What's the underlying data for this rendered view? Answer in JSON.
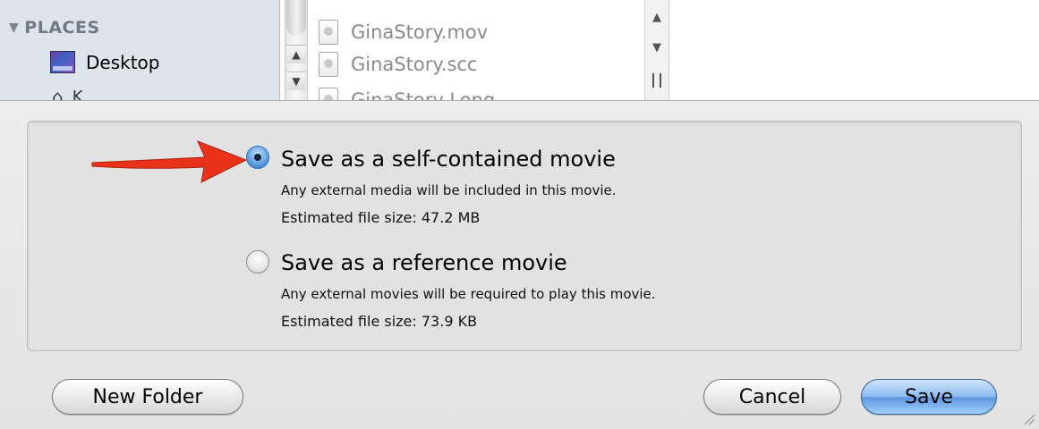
{
  "sidebar": {
    "header": "PLACES",
    "items": [
      {
        "label": "Desktop",
        "icon": "desktop-icon"
      },
      {
        "label": "K",
        "icon": "home-icon"
      }
    ]
  },
  "files": [
    "GinaStory.mov",
    "GinaStory.scc",
    "GinaStory Long"
  ],
  "options": {
    "self_contained": {
      "title": "Save as a self-contained movie",
      "description": "Any external media will be included in this movie.",
      "size": "Estimated file size:  47.2 MB",
      "selected": true
    },
    "reference": {
      "title": "Save as a reference movie",
      "description": "Any external movies will be required to play this movie.",
      "size": "Estimated file size:  73.9 KB",
      "selected": false
    }
  },
  "buttons": {
    "new_folder": "New Folder",
    "cancel": "Cancel",
    "save": "Save"
  },
  "colors": {
    "arrow": "#e8321a",
    "default_button": "#5d97df",
    "sidebar": "#dde4ec"
  }
}
